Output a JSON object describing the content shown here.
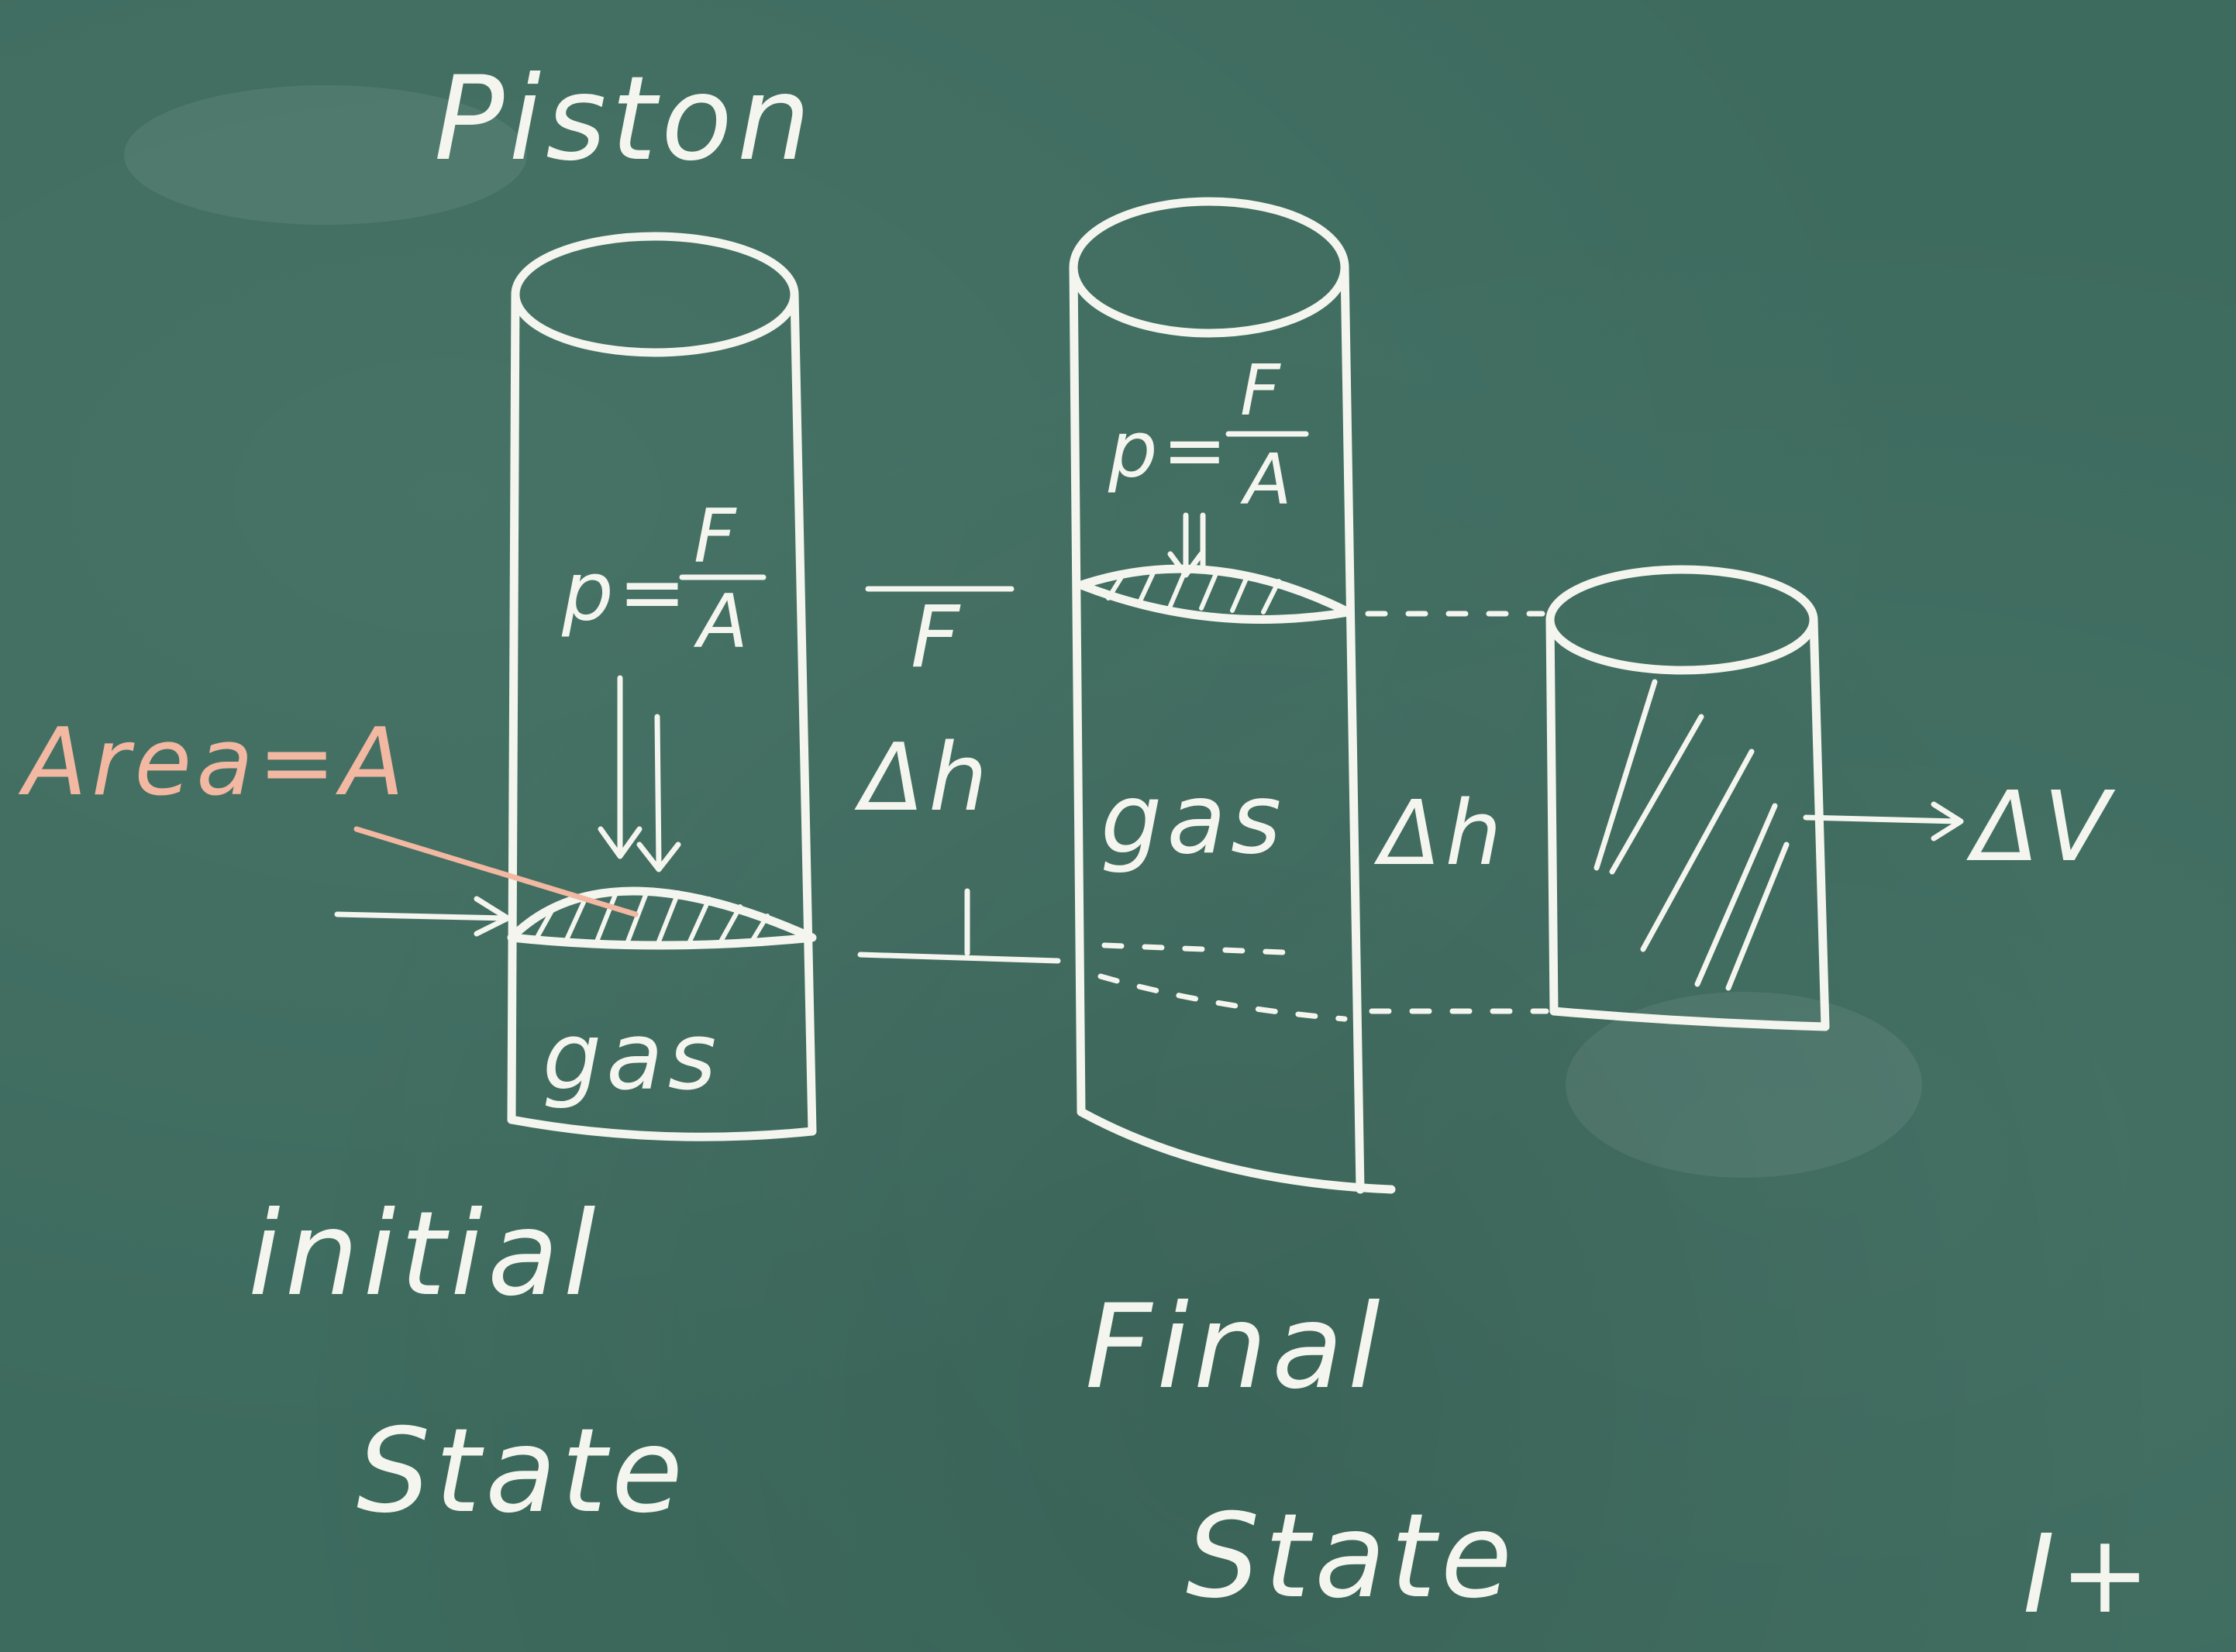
{
  "title": "Piston",
  "area_label": "Area=A",
  "initial": {
    "pressure": "p=",
    "fraction_num": "F",
    "fraction_den": "A",
    "gas": "gas",
    "state_line1": "initial",
    "state_line2": "State"
  },
  "final": {
    "pressure": "p=",
    "fraction_num": "F",
    "fraction_den": "A",
    "gas": "gas",
    "state_line1": "Final",
    "state_line2": "State"
  },
  "force_label": "F",
  "delta_h": "Δh",
  "delta_h_small": "Δh",
  "delta_v": "ΔV",
  "corner_mark": "I+",
  "colors": {
    "board": "#3d6b5e",
    "chalk": "#f3f5ee",
    "chalk_orange": "#f2b8a2"
  }
}
